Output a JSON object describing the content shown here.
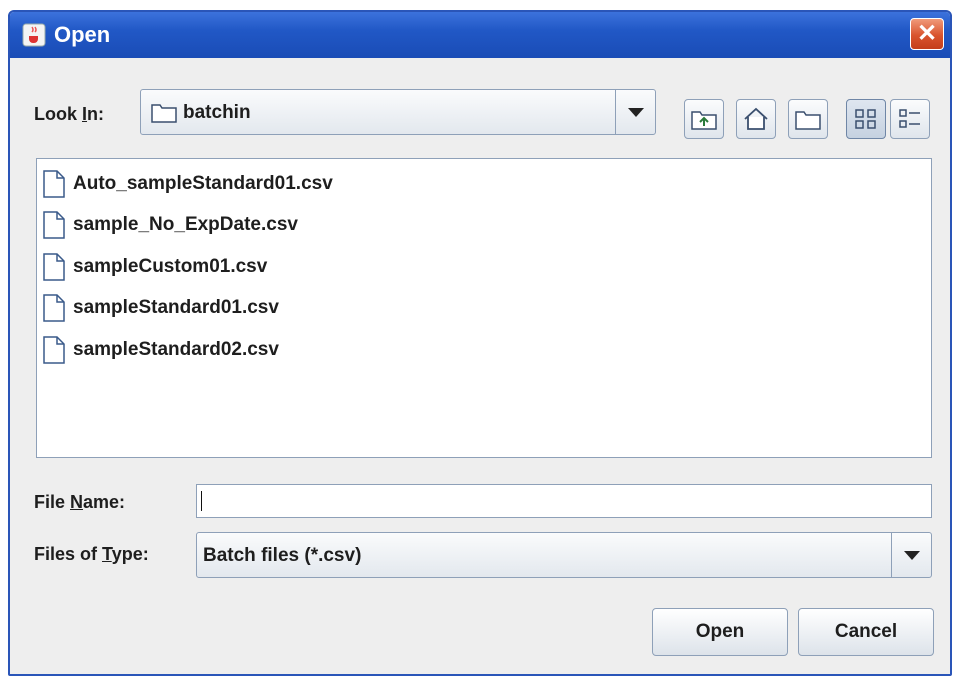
{
  "window": {
    "title": "Open",
    "icon": "java-cup-icon",
    "close_icon": "close-icon"
  },
  "look_in": {
    "label_prefix": "Look ",
    "label_mnemonic": "I",
    "label_suffix": "n:",
    "value": "batchin",
    "folder_icon": "folder-icon"
  },
  "toolbar": [
    {
      "name": "up-one-level-button",
      "icon": "up-folder-icon"
    },
    {
      "name": "home-button",
      "icon": "home-icon"
    },
    {
      "name": "new-folder-button",
      "icon": "new-folder-icon"
    },
    {
      "name": "list-view-button",
      "icon": "list-view-icon",
      "selected": true
    },
    {
      "name": "details-view-button",
      "icon": "details-view-icon"
    }
  ],
  "files": [
    "Auto_sampleStandard01.csv",
    "sample_No_ExpDate.csv",
    "sampleCustom01.csv",
    "sampleStandard01.csv",
    "sampleStandard02.csv"
  ],
  "file_name": {
    "label_prefix": "File ",
    "label_mnemonic": "N",
    "label_suffix": "ame:",
    "value": ""
  },
  "files_of_type": {
    "label_prefix": "Files of ",
    "label_mnemonic": "T",
    "label_suffix": "ype:",
    "value": "Batch files (*.csv)"
  },
  "buttons": {
    "open": "Open",
    "cancel": "Cancel"
  },
  "colors": {
    "titlebar": "#2158c6",
    "close": "#d9542e",
    "background": "#eeeeee"
  }
}
